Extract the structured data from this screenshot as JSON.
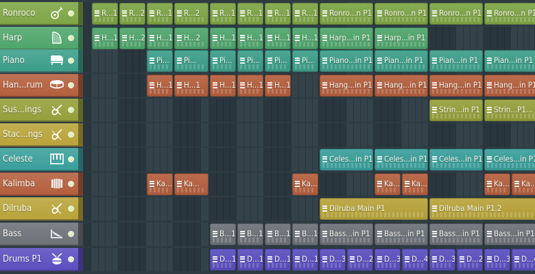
{
  "tracks": [
    {
      "name": "Ronroco",
      "color": "#7ea545",
      "icon": "guitar-icon",
      "clips": [
        {
          "start": 0,
          "len": 1,
          "label": "R...1"
        },
        {
          "start": 1,
          "len": 1,
          "label": "R...2"
        },
        {
          "start": 2,
          "len": 1,
          "label": "R...1"
        },
        {
          "start": 3,
          "len": 1,
          "label": "R...2"
        },
        {
          "start": 4,
          "len": 1,
          "label": "R...1"
        },
        {
          "start": 5,
          "len": 1,
          "label": "R...1"
        },
        {
          "start": 6,
          "len": 1,
          "label": "R...1"
        },
        {
          "start": 7,
          "len": 1,
          "label": "R...1"
        },
        {
          "start": 8,
          "len": 2,
          "label": "Ronro...n P1"
        },
        {
          "start": 10,
          "len": 2,
          "label": "Ronro...n P1"
        },
        {
          "start": 12,
          "len": 2,
          "label": "Ronro...n P1"
        },
        {
          "start": 14,
          "len": 2,
          "label": "Ronro...n P1"
        }
      ]
    },
    {
      "name": "Harp",
      "color": "#4fa56b",
      "icon": "harp-icon",
      "clips": [
        {
          "start": 0,
          "len": 1,
          "label": "H...1"
        },
        {
          "start": 1,
          "len": 1,
          "label": "H...2"
        },
        {
          "start": 2,
          "len": 1,
          "label": "H...1"
        },
        {
          "start": 3,
          "len": 1,
          "label": "H...2"
        },
        {
          "start": 4,
          "len": 1,
          "label": "H...1"
        },
        {
          "start": 5,
          "len": 1,
          "label": "H...1"
        },
        {
          "start": 6,
          "len": 1,
          "label": "H...1"
        },
        {
          "start": 7,
          "len": 1,
          "label": "H...1"
        },
        {
          "start": 8,
          "len": 2,
          "label": "Harp...in P1"
        },
        {
          "start": 10,
          "len": 2,
          "label": "Harp...in P1"
        }
      ]
    },
    {
      "name": "Piano",
      "color": "#3c9e8a",
      "icon": "piano-icon",
      "clips": [
        {
          "start": 2,
          "len": 1,
          "label": "Pi..."
        },
        {
          "start": 3,
          "len": 1,
          "label": "Pi..."
        },
        {
          "start": 4,
          "len": 1,
          "label": "Pi..."
        },
        {
          "start": 5,
          "len": 1,
          "label": "Pi..."
        },
        {
          "start": 6,
          "len": 1,
          "label": "Pi..."
        },
        {
          "start": 7,
          "len": 1,
          "label": "Pi..."
        },
        {
          "start": 8,
          "len": 2,
          "label": "Piano...in P1"
        },
        {
          "start": 10,
          "len": 2,
          "label": "Pian...in P1"
        },
        {
          "start": 12,
          "len": 2,
          "label": "Pian...in P1"
        },
        {
          "start": 14,
          "len": 2,
          "label": "Pian...in P1"
        }
      ]
    },
    {
      "name": "Han...rum",
      "color": "#b45f3e",
      "icon": "handdrum-icon",
      "clips": [
        {
          "start": 2,
          "len": 1,
          "label": "H...1"
        },
        {
          "start": 3,
          "len": 1,
          "label": "H...1"
        },
        {
          "start": 4,
          "len": 1,
          "label": "H...1"
        },
        {
          "start": 5,
          "len": 1,
          "label": "H...1"
        },
        {
          "start": 6,
          "len": 1,
          "label": "H...1"
        },
        {
          "start": 8,
          "len": 2,
          "label": "Hang...in P1"
        },
        {
          "start": 10,
          "len": 2,
          "label": "Hang...in P1"
        },
        {
          "start": 12,
          "len": 2,
          "label": "Hang...in P1"
        },
        {
          "start": 14,
          "len": 2,
          "label": "Hang...in P1"
        }
      ]
    },
    {
      "name": "Sus...ings",
      "color": "#93a03a",
      "icon": "violin-icon",
      "clips": [
        {
          "start": 12,
          "len": 2,
          "label": "Strin...in P1"
        },
        {
          "start": 14,
          "len": 2,
          "label": "Strin...P1..."
        }
      ]
    },
    {
      "name": "Stac...ngs",
      "color": "#b8a43a",
      "icon": "violin-icon",
      "clips": []
    },
    {
      "name": "Celeste",
      "color": "#3a9f9b",
      "icon": "celeste-icon",
      "clips": [
        {
          "start": 8,
          "len": 2,
          "label": "Celes...in P1"
        },
        {
          "start": 10,
          "len": 2,
          "label": "Celes...in P1"
        },
        {
          "start": 12,
          "len": 2,
          "label": "Celes...in P1"
        },
        {
          "start": 14,
          "len": 2,
          "label": "Celes...in P1"
        }
      ]
    },
    {
      "name": "Kalimba",
      "color": "#b45f3e",
      "icon": "kalimba-icon",
      "clips": [
        {
          "start": 2,
          "len": 1,
          "label": "Ka..."
        },
        {
          "start": 3,
          "len": 1,
          "label": "Ka..."
        },
        {
          "start": 7,
          "len": 1,
          "label": "Ka..."
        },
        {
          "start": 10,
          "len": 1,
          "label": "Ka..."
        },
        {
          "start": 11,
          "len": 1,
          "label": "Ka..."
        },
        {
          "start": 14,
          "len": 1,
          "label": "Ka..."
        },
        {
          "start": 15,
          "len": 1,
          "label": "Ka..."
        }
      ]
    },
    {
      "name": "Dilruba",
      "color": "#b8a43a",
      "icon": "violin-icon",
      "clips": [
        {
          "start": 8,
          "len": 4,
          "label": "Dilruba Main P1"
        },
        {
          "start": 12,
          "len": 4,
          "label": "Dilruba Main P1.2"
        }
      ]
    },
    {
      "name": "Bass",
      "color": "#6b7278",
      "icon": "bass-icon",
      "clips": [
        {
          "start": 4,
          "len": 1,
          "label": "B...1"
        },
        {
          "start": 5,
          "len": 1,
          "label": "B...1"
        },
        {
          "start": 6,
          "len": 1,
          "label": "B...1"
        },
        {
          "start": 7,
          "len": 1,
          "label": "B...1"
        },
        {
          "start": 8,
          "len": 2,
          "label": "Bass...in P1"
        },
        {
          "start": 10,
          "len": 2,
          "label": "Bass...in P1"
        },
        {
          "start": 12,
          "len": 2,
          "label": "Bass...in P1"
        },
        {
          "start": 14,
          "len": 2,
          "label": "Bass...in P1"
        }
      ]
    },
    {
      "name": "Drums P1",
      "color": "#5a4fc0",
      "icon": "drum-icon",
      "clips": [
        {
          "start": 4,
          "len": 1,
          "label": "D...1"
        },
        {
          "start": 5,
          "len": 1,
          "label": "D...1"
        },
        {
          "start": 6,
          "len": 1,
          "label": "D...1"
        },
        {
          "start": 7,
          "len": 1,
          "label": "D...1"
        },
        {
          "start": 8,
          "len": 1,
          "label": "D...3"
        },
        {
          "start": 9,
          "len": 1,
          "label": "D...2"
        },
        {
          "start": 10,
          "len": 1,
          "label": "D...3"
        },
        {
          "start": 11,
          "len": 1,
          "label": "D...4"
        },
        {
          "start": 12,
          "len": 1,
          "label": "D...3"
        },
        {
          "start": 13,
          "len": 1,
          "label": "D...2"
        },
        {
          "start": 14,
          "len": 1,
          "label": "D...3"
        },
        {
          "start": 15,
          "len": 1,
          "label": "D...4"
        }
      ]
    }
  ]
}
